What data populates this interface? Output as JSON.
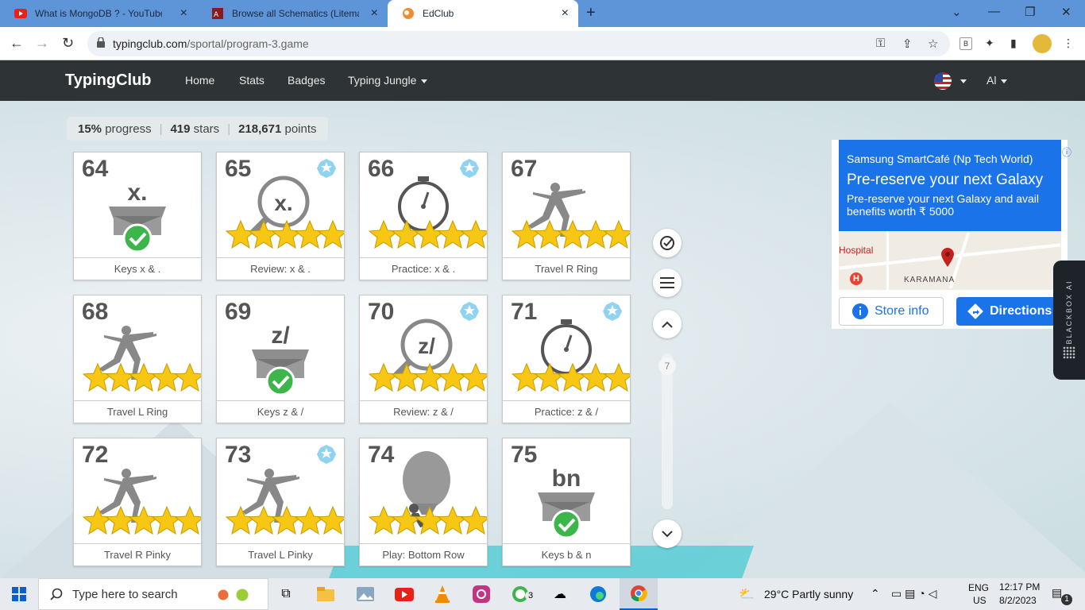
{
  "browser": {
    "tabs": [
      {
        "title": "What is MongoDB ? - YouTube",
        "active": false
      },
      {
        "title": "Browse all Schematics (Litematica",
        "active": false
      },
      {
        "title": "EdClub",
        "active": true
      }
    ],
    "url_host": "typingclub.com",
    "url_path": "/sportal/program-3.game",
    "ext_letter": "B"
  },
  "site": {
    "logo": "TypingClub",
    "nav": [
      {
        "label": "Home"
      },
      {
        "label": "Stats"
      },
      {
        "label": "Badges"
      },
      {
        "label": "Typing Jungle"
      }
    ],
    "user": "Al"
  },
  "progress": {
    "percent": "15%",
    "percent_label": "progress",
    "stars": "419",
    "stars_label": "stars",
    "points": "218,671",
    "points_label": "points"
  },
  "lessons": [
    {
      "num": "64",
      "label": "Keys x & .",
      "kind": "keys",
      "keys": "x.",
      "stars": 0,
      "badge": false
    },
    {
      "num": "65",
      "label": "Review: x & .",
      "kind": "review",
      "keys": "x.",
      "stars": 5,
      "badge": true
    },
    {
      "num": "66",
      "label": "Practice: x & .",
      "kind": "practice",
      "keys": "",
      "stars": 5,
      "badge": true
    },
    {
      "num": "67",
      "label": "Travel R Ring",
      "kind": "travel",
      "keys": "",
      "stars": 5,
      "badge": false
    },
    {
      "num": "68",
      "label": "Travel L Ring",
      "kind": "travel",
      "keys": "",
      "stars": 5,
      "badge": false
    },
    {
      "num": "69",
      "label": "Keys z & /",
      "kind": "keys",
      "keys": "z/",
      "stars": 0,
      "badge": false
    },
    {
      "num": "70",
      "label": "Review: z & /",
      "kind": "review",
      "keys": "z/",
      "stars": 5,
      "badge": true
    },
    {
      "num": "71",
      "label": "Practice: z & /",
      "kind": "practice",
      "keys": "",
      "stars": 5,
      "badge": true
    },
    {
      "num": "72",
      "label": "Travel R Pinky",
      "kind": "travel",
      "keys": "",
      "stars": 5,
      "badge": false
    },
    {
      "num": "73",
      "label": "Travel L Pinky",
      "kind": "travel",
      "keys": "",
      "stars": 5,
      "badge": true
    },
    {
      "num": "74",
      "label": "Play: Bottom Row",
      "kind": "play",
      "keys": "",
      "stars": 5,
      "badge": false
    },
    {
      "num": "75",
      "label": "Keys b & n",
      "kind": "keys",
      "keys": "bn",
      "stars": 0,
      "badge": false
    }
  ],
  "scroller": {
    "page": "7"
  },
  "ad": {
    "sponsor": "Samsung SmartCafé (Np Tech World)",
    "headline": "Pre-reserve your next Galaxy",
    "body": "Pre-reserve your next Galaxy and avail benefits worth ₹ 5000",
    "map_label_1": "Hospital",
    "map_label_2": "KARAMANA",
    "btn_store": "Store info",
    "btn_directions": "Directions"
  },
  "blackbox": "BLACKBOX AI",
  "taskbar": {
    "search": "Type here to search",
    "whatsapp_count": "3",
    "weather": "29°C  Partly sunny",
    "lang1": "ENG",
    "lang2": "US",
    "time": "12:17 PM",
    "date": "8/2/2023",
    "notif": "1"
  },
  "colors": {
    "accent": "#1a73e8",
    "navbar": "#2e3335",
    "star": "#f7c713",
    "check": "#3cb54a"
  }
}
